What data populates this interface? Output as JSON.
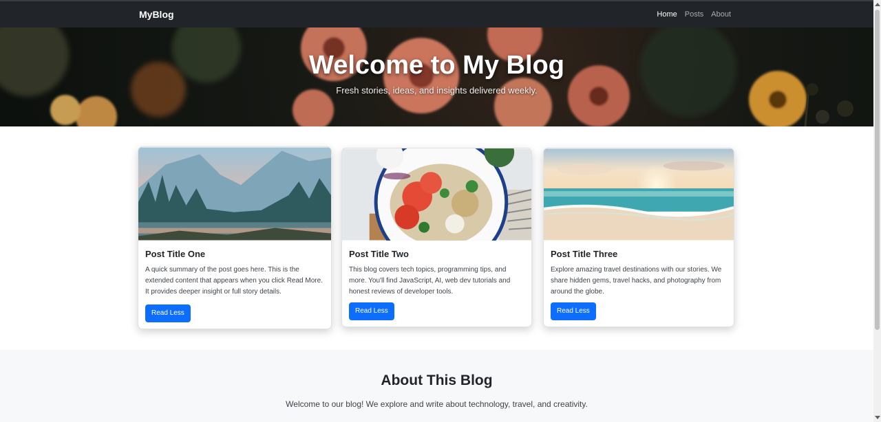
{
  "navbar": {
    "brand": "MyBlog",
    "links": [
      {
        "label": "Home",
        "active": true
      },
      {
        "label": "Posts",
        "active": false
      },
      {
        "label": "About",
        "active": false
      }
    ]
  },
  "hero": {
    "title": "Welcome to My Blog",
    "subtitle": "Fresh stories, ideas, and insights delivered weekly."
  },
  "posts": [
    {
      "title": "Post Title One",
      "text": "A quick summary of the post goes here. This is the extended content that appears when you click Read More. It provides deeper insight or full story details.",
      "button": "Read Less",
      "image": "mountain-lake-photo"
    },
    {
      "title": "Post Title Two",
      "text": "This blog covers tech topics, programming tips, and more. You'll find JavaScript, AI, web dev tutorials and honest reviews of developer tools.",
      "button": "Read Less",
      "image": "salad-bowl-photo"
    },
    {
      "title": "Post Title Three",
      "text": "Explore amazing travel destinations with our stories. We share hidden gems, travel hacks, and photography from around the globe.",
      "button": "Read Less",
      "image": "beach-sunset-photo"
    }
  ],
  "about": {
    "title": "About This Blog",
    "text": "Welcome to our blog! We explore and write about technology, travel, and creativity."
  },
  "colors": {
    "navbar_bg": "#212529",
    "primary": "#0d6efd",
    "about_bg": "#f7f8f9"
  }
}
